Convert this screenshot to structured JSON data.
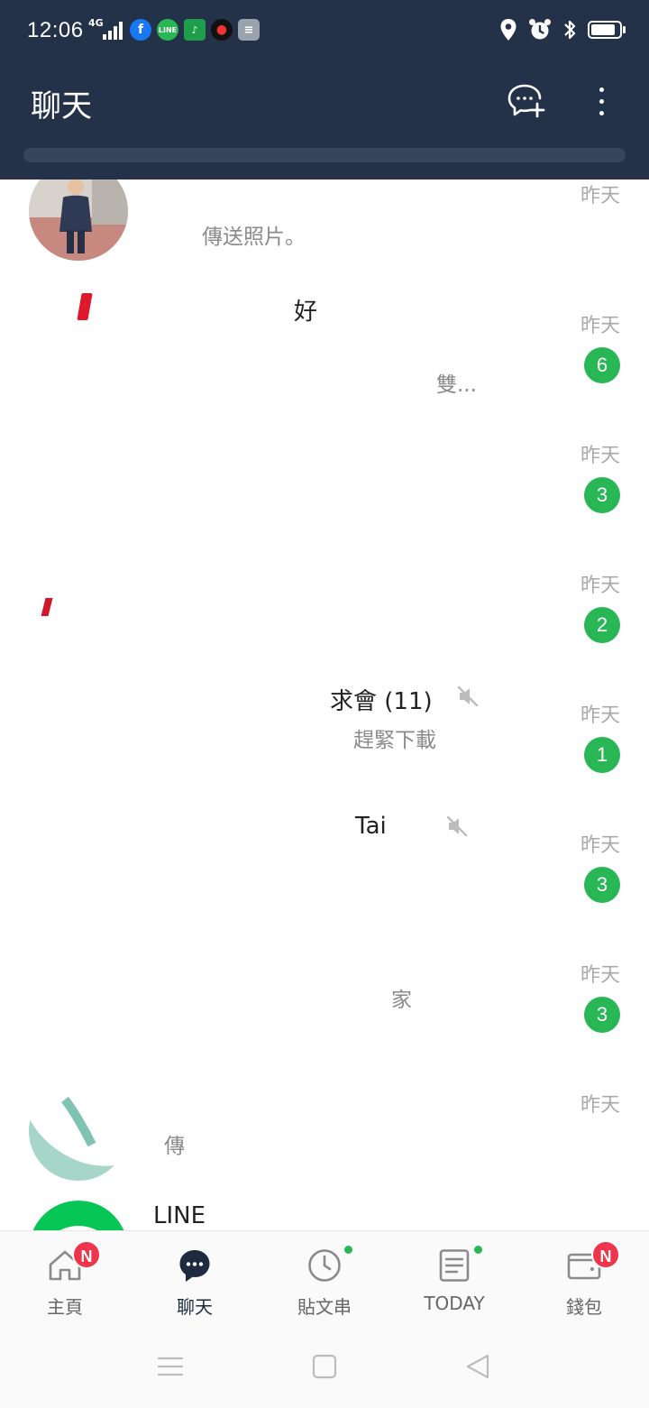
{
  "status_bar": {
    "time": "12:06",
    "network": "4G",
    "app_icons": [
      "facebook-icon",
      "line-icon",
      "app-icon-green",
      "app-icon-red",
      "app-icon-gray"
    ],
    "right_icons": [
      "location-icon",
      "alarm-icon",
      "bluetooth-icon",
      "battery-icon"
    ],
    "battery_level": 0.9
  },
  "header": {
    "title": "聊天",
    "bg_color": "#243249"
  },
  "chats": [
    {
      "name": "",
      "preview": "傳送照片。",
      "time": "昨天",
      "unread": "",
      "muted": false
    },
    {
      "name": "好",
      "preview": "雙...",
      "time": "昨天",
      "unread": "6",
      "muted": false
    },
    {
      "name": "",
      "preview": "",
      "time": "昨天",
      "unread": "3",
      "muted": false
    },
    {
      "name": "",
      "preview": "",
      "time": "昨天",
      "unread": "2",
      "muted": false
    },
    {
      "name": "求會 (11)",
      "preview": "趕緊下載",
      "time": "昨天",
      "unread": "1",
      "muted": true
    },
    {
      "name": "Tai",
      "preview": "",
      "time": "昨天",
      "unread": "3",
      "muted": true
    },
    {
      "name": "",
      "preview": "家",
      "time": "昨天",
      "unread": "3",
      "muted": false
    },
    {
      "name": "",
      "preview": "傳",
      "time": "昨天",
      "unread": "",
      "muted": false
    },
    {
      "name": "LINE",
      "preview": "",
      "time": "",
      "unread": "",
      "muted": false
    }
  ],
  "bottom_nav": {
    "items": [
      {
        "label": "主頁",
        "badge": "N",
        "dot": false,
        "active": false
      },
      {
        "label": "聊天",
        "badge": "",
        "dot": false,
        "active": true
      },
      {
        "label": "貼文串",
        "badge": "",
        "dot": true,
        "active": false
      },
      {
        "label": "TODAY",
        "badge": "",
        "dot": true,
        "active": false
      },
      {
        "label": "錢包",
        "badge": "N",
        "dot": false,
        "active": false
      }
    ]
  },
  "colors": {
    "accent_green": "#29b755",
    "badge_red": "#f0344b",
    "header_bg": "#243249"
  }
}
